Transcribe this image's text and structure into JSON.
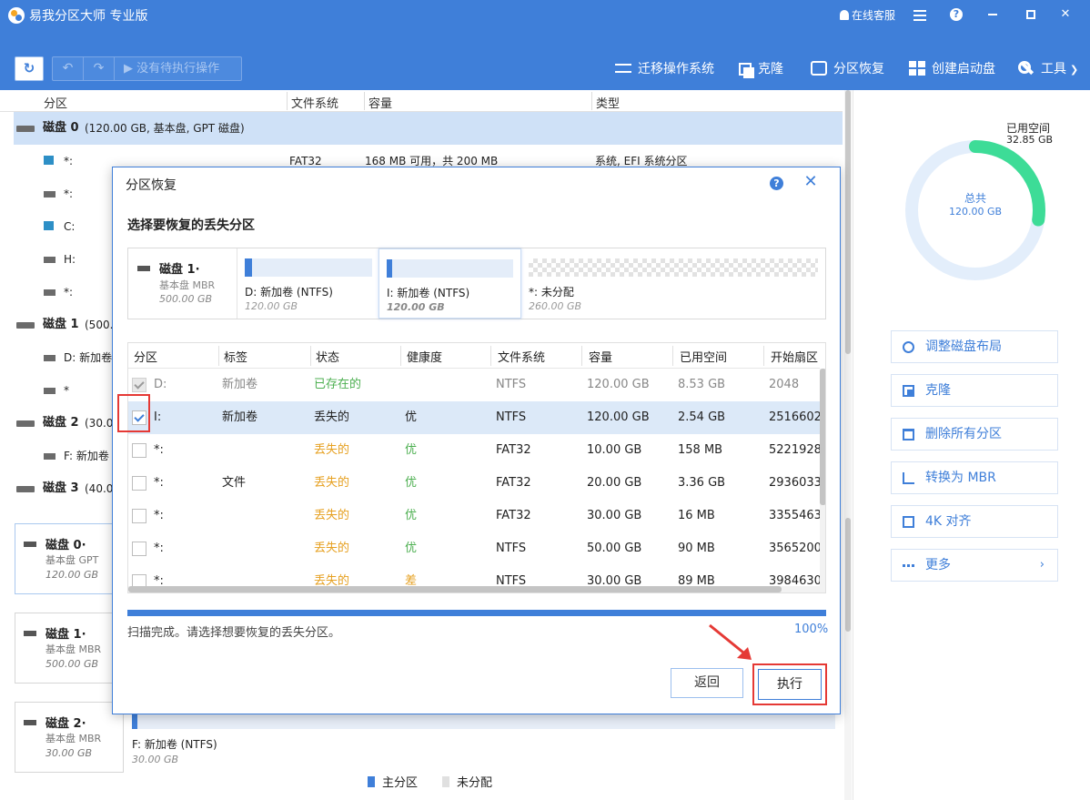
{
  "app": {
    "title": "易我分区大师 专业版",
    "online_service": "在线客服",
    "accent_color": "#3f7fd9"
  },
  "toolbar": {
    "pending": "▶ 没有待执行操作",
    "migrate_os": "迁移操作系统",
    "clone": "克隆",
    "partition_recovery": "分区恢复",
    "create_boot_disk": "创建启动盘",
    "tools": "工具"
  },
  "columns": {
    "partition": "分区",
    "filesystem": "文件系统",
    "capacity": "容量",
    "type": "类型"
  },
  "disks": [
    {
      "name": "磁盘 0",
      "info": "(120.00 GB, 基本盘, GPT 磁盘)"
    },
    {
      "name": "磁盘 1",
      "info": "(500."
    },
    {
      "name": "磁盘 2",
      "info": "(30.0"
    },
    {
      "name": "磁盘 3",
      "info": "(40.0"
    }
  ],
  "partitions": [
    {
      "name": "*:",
      "fs": "FAT32",
      "cap": "168 MB    可用，共  200 MB",
      "type": "系统, EFI 系统分区"
    },
    {
      "name": "*:"
    },
    {
      "name": "C:"
    },
    {
      "name": "H:"
    },
    {
      "name": "*:"
    },
    {
      "name": "D: 新加卷"
    },
    {
      "name": "*"
    },
    {
      "name": "F: 新加卷"
    }
  ],
  "disk_cards": [
    {
      "name": "磁盘 0·",
      "sub": "基本盘 GPT",
      "size": "120.00 GB"
    },
    {
      "name": "磁盘 1·",
      "sub": "基本盘 MBR",
      "size": "500.00 GB"
    },
    {
      "name": "磁盘 2·",
      "sub": "基本盘 MBR",
      "size": "30.00 GB"
    }
  ],
  "bg_map": {
    "label": "F: 新加卷 (NTFS)",
    "size": "30.00 GB"
  },
  "legend": {
    "primary": "主分区",
    "unallocated": "未分配"
  },
  "usage": {
    "used_label": "已用空间",
    "used_value": "32.85 GB",
    "total_label": "总共",
    "total_value": "120.00 GB",
    "used_fraction": 0.274
  },
  "actions": {
    "adjust_layout": "调整磁盘布局",
    "clone": "克隆",
    "delete_all": "删除所有分区",
    "convert_mbr": "转换为 MBR",
    "align_4k": "4K 对齐",
    "more": "更多"
  },
  "dialog": {
    "title": "分区恢复",
    "heading": "选择要恢复的丢失分区",
    "disk": {
      "name": "磁盘 1·",
      "sub": "基本盘 MBR",
      "size": "500.00 GB"
    },
    "segments": [
      {
        "label": "D: 新加卷 (NTFS)",
        "size": "120.00 GB",
        "used_fraction": 0.06
      },
      {
        "label": "I: 新加卷 (NTFS)",
        "size": "120.00 GB",
        "used_fraction": 0.02
      },
      {
        "label": "*: 未分配",
        "size": "260.00 GB"
      }
    ],
    "table_headers": [
      "分区",
      "标签",
      "状态",
      "健康度",
      "文件系统",
      "容量",
      "已用空间",
      "开始扇区"
    ],
    "rows": [
      {
        "partition": "D:",
        "label": "新加卷",
        "status": "已存在的",
        "health": "",
        "fs": "NTFS",
        "cap": "120.00 GB",
        "used": "8.53 GB",
        "start": "2048"
      },
      {
        "partition": "I:",
        "label": "新加卷",
        "status": "丢失的",
        "health": "优",
        "fs": "NTFS",
        "cap": "120.00 GB",
        "used": "2.54 GB",
        "start": "2516602"
      },
      {
        "partition": "*:",
        "label": "",
        "status": "丢失的",
        "health": "优",
        "fs": "FAT32",
        "cap": "10.00 GB",
        "used": "158 MB",
        "start": "5221928"
      },
      {
        "partition": "*:",
        "label": "文件",
        "status": "丢失的",
        "health": "优",
        "fs": "FAT32",
        "cap": "20.00 GB",
        "used": "3.36 GB",
        "start": "2936033"
      },
      {
        "partition": "*:",
        "label": "",
        "status": "丢失的",
        "health": "优",
        "fs": "FAT32",
        "cap": "30.00 GB",
        "used": "16 MB",
        "start": "3355463"
      },
      {
        "partition": "*:",
        "label": "",
        "status": "丢失的",
        "health": "优",
        "fs": "NTFS",
        "cap": "50.00 GB",
        "used": "90 MB",
        "start": "3565200"
      },
      {
        "partition": "*:",
        "label": "",
        "status": "丢失的",
        "health": "差",
        "fs": "NTFS",
        "cap": "30.00 GB",
        "used": "89 MB",
        "start": "3984630"
      }
    ],
    "scan_message": "扫描完成。请选择想要恢复的丢失分区。",
    "progress_text": "100%",
    "back_label": "返回",
    "execute_label": "执行"
  }
}
